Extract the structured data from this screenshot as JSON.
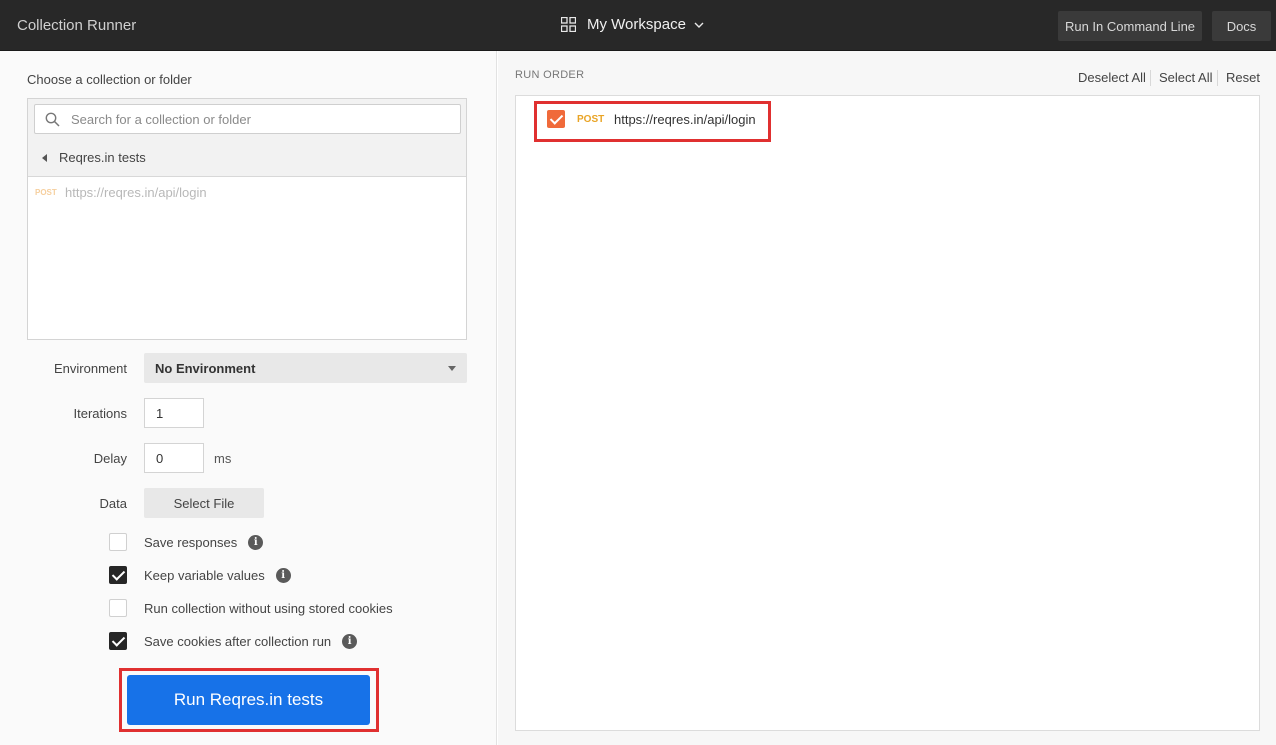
{
  "header": {
    "app_title": "Collection Runner",
    "workspace": "My Workspace",
    "run_cli_label": "Run In Command Line",
    "docs_label": "Docs"
  },
  "left": {
    "choose_label": "Choose a collection or folder",
    "search_placeholder": "Search for a collection or folder",
    "breadcrumb": "Reqres.in tests",
    "requests": [
      {
        "method": "POST",
        "url": "https://reqres.in/api/login"
      }
    ],
    "environment_label": "Environment",
    "environment_value": "No Environment",
    "iterations_label": "Iterations",
    "iterations_value": "1",
    "delay_label": "Delay",
    "delay_value": "0",
    "delay_unit": "ms",
    "data_label": "Data",
    "select_file_label": "Select File",
    "options": [
      {
        "label": "Save responses",
        "checked": false,
        "info": true
      },
      {
        "label": "Keep variable values",
        "checked": true,
        "info": true
      },
      {
        "label": "Run collection without using stored cookies",
        "checked": false,
        "info": false
      },
      {
        "label": "Save cookies after collection run",
        "checked": true,
        "info": true
      }
    ],
    "run_button_label": "Run Reqres.in tests"
  },
  "right": {
    "run_order_label": "RUN ORDER",
    "deselect_all_label": "Deselect All",
    "select_all_label": "Select All",
    "reset_label": "Reset",
    "items": [
      {
        "method": "POST",
        "url": "https://reqres.in/api/login",
        "checked": true
      }
    ]
  },
  "colors": {
    "accent_blue": "#1772e8",
    "highlight_red": "#e03030",
    "checkbox_orange": "#f06a3a",
    "post_method": "#e9a426"
  }
}
